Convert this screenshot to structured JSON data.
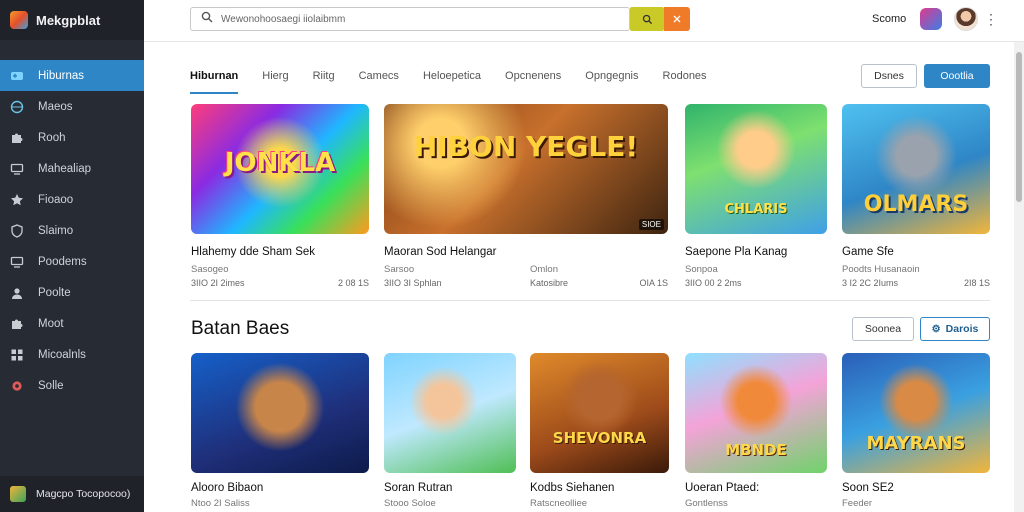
{
  "app": {
    "name": "Mekgpblat"
  },
  "sidebar": {
    "items": [
      {
        "label": "Hiburnas",
        "icon": "controller-icon",
        "active": true
      },
      {
        "label": "Maeos",
        "icon": "globe-icon"
      },
      {
        "label": "Rooh",
        "icon": "puzzle-icon"
      },
      {
        "label": "Mahealiap",
        "icon": "monitor-icon"
      },
      {
        "label": "Fioaoo",
        "icon": "star-icon"
      },
      {
        "label": "Slaimo",
        "icon": "shield-icon"
      },
      {
        "label": "Poodems",
        "icon": "monitor-icon"
      },
      {
        "label": "Poolte",
        "icon": "user-icon"
      },
      {
        "label": "Moot",
        "icon": "puzzle-icon"
      },
      {
        "label": "Micoalnls",
        "icon": "grid-icon"
      },
      {
        "label": "Solle",
        "icon": "gear-icon"
      }
    ],
    "footer": "Magcpo Tocopocoo)"
  },
  "header": {
    "search_value": "Wewonohoosaegi iiolaibmm",
    "search_icon": "search-icon",
    "user_name": "Scomo"
  },
  "tabs": [
    "Hiburnan",
    "Hierg",
    "Riitg",
    "Camecs",
    "Heloepetica",
    "Opcnenens",
    "Opngegnis",
    "Rodones"
  ],
  "top_buttons": {
    "secondary": "Dsnes",
    "primary": "Oootlia"
  },
  "featured": [
    {
      "thumb_text": "JONKLA",
      "title": "Hlahemy dde Sham Sek",
      "subtitle": "Sasogeo",
      "meta_left": "3IIO 2I 2imes",
      "meta_right": "2 08 1S"
    },
    {
      "thumb_text": "HIBON YEGLE!",
      "badge": "SIOE",
      "title": "Maoran Sod Helangar",
      "subtitle": "Sarsoo",
      "meta_left": "3IIO 3I Sphlan",
      "meta_right": "",
      "subtitle2": "Omlon",
      "meta2_left": "Katosibre",
      "meta2_right": "OIA 1S"
    },
    {
      "thumb_text": "CHLARIS",
      "title": "Saepone Pla Kanag",
      "subtitle": "Sonpoa",
      "meta_left": "3IIO 00 2 2ms",
      "meta_right": ""
    },
    {
      "thumb_text": "OLMARS",
      "title": "Game Sfe",
      "subtitle": "Poodts Husanaoin",
      "meta_left": "3 I2 2C 2Iums",
      "meta_right": "2I8 1S"
    }
  ],
  "section": {
    "title": "Batan Baes",
    "button_secondary": "Soonea",
    "button_primary": "Darois"
  },
  "games": [
    {
      "thumb_text": "",
      "title": "Alooro Bibaon",
      "subtitle": "Ntoo 2I Saliss"
    },
    {
      "thumb_text": "",
      "title": "Soran Rutran",
      "subtitle": "Stooo Soloe"
    },
    {
      "thumb_text": "SHEVONRA",
      "title": "Kodbs Siehanen",
      "subtitle": "Ratscneolliee"
    },
    {
      "thumb_text": "MBNDE",
      "title": "Uoeran Ptaed:",
      "subtitle": "Gontlenss"
    },
    {
      "thumb_text": "MAYRANS",
      "title": "Soon SE2",
      "subtitle": "Feeder"
    }
  ]
}
